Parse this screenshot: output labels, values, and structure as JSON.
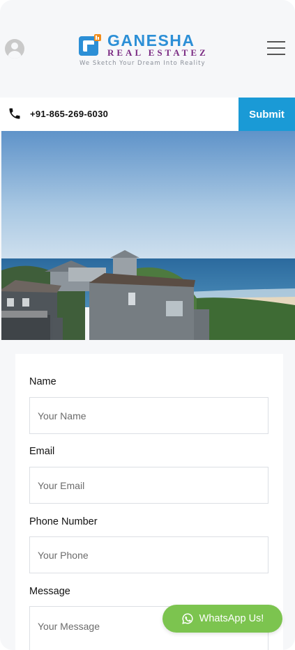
{
  "header": {
    "logo_name": "GANESHA",
    "logo_sub": "REAL ESTATEZ",
    "logo_tagline": "We Sketch Your Dream Into Reality"
  },
  "contact_bar": {
    "phone": "+91-865-269-6030",
    "submit_label": "Submit"
  },
  "form": {
    "fields": [
      {
        "label": "Name",
        "placeholder": "Your Name"
      },
      {
        "label": "Email",
        "placeholder": "Your Email"
      },
      {
        "label": "Phone Number",
        "placeholder": "Your Phone"
      },
      {
        "label": "Message",
        "placeholder": "Your Message"
      }
    ]
  },
  "whatsapp": {
    "label": "WhatsApp Us!"
  },
  "colors": {
    "brand_blue": "#1a9ad6",
    "brand_purple": "#7a2a82",
    "whatsapp_green": "#7cc44f"
  },
  "icons": [
    "user-icon",
    "menu-icon",
    "phone-icon",
    "whatsapp-icon"
  ]
}
